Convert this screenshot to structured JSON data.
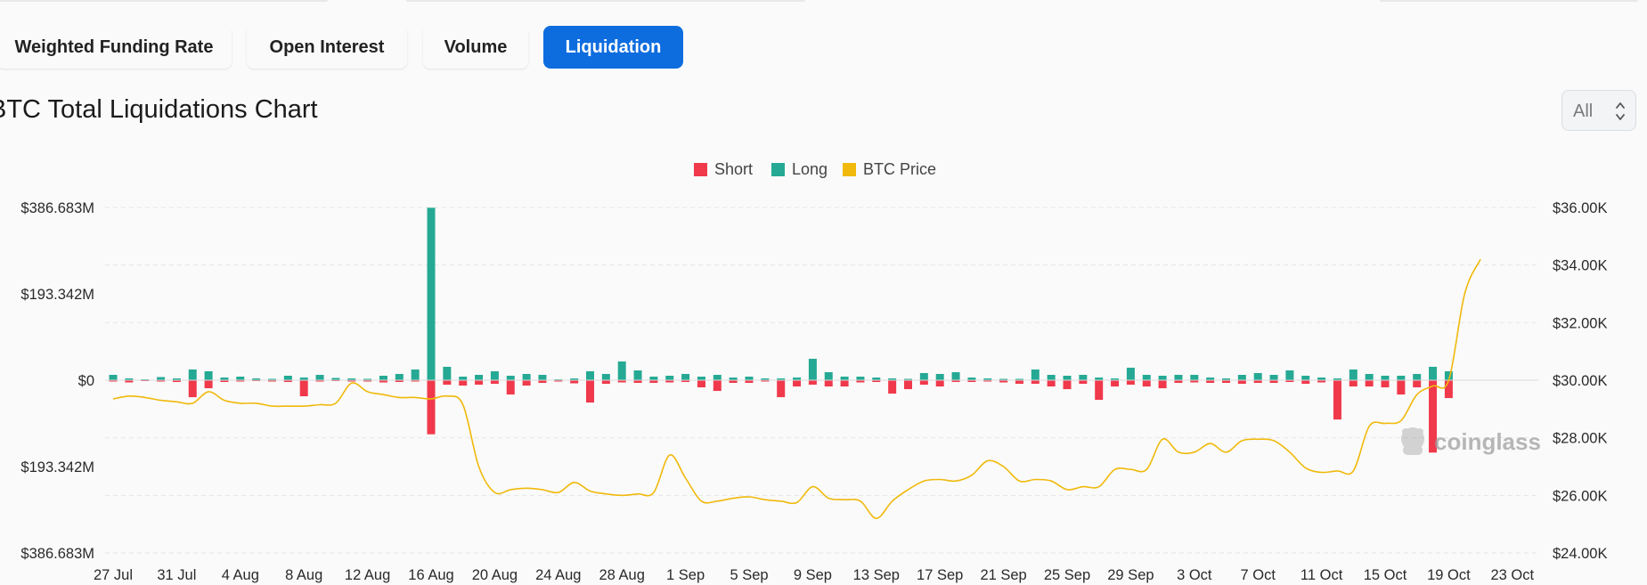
{
  "tabs": [
    {
      "label": "Weighted Funding Rate",
      "active": false
    },
    {
      "label": "Open Interest",
      "active": false
    },
    {
      "label": "Volume",
      "active": false
    },
    {
      "label": "Liquidation",
      "active": true
    }
  ],
  "title": "BTC Total Liquidations Chart",
  "range_select": {
    "value": "All"
  },
  "colors": {
    "short": "#f0394b",
    "long": "#26a994",
    "price": "#f0b90b",
    "accent": "#0d6ddf"
  },
  "watermark": "coinglass",
  "chart_data": {
    "type": "bar",
    "title": "BTC Total Liquidations Chart",
    "legend": [
      {
        "name": "Short",
        "color": "#f0394b"
      },
      {
        "name": "Long",
        "color": "#26a994"
      },
      {
        "name": "BTC Price",
        "color": "#f0b90b"
      }
    ],
    "legend_position": "top-center",
    "grid": true,
    "x_tick_labels": [
      "27 Jul",
      "31 Jul",
      "4 Aug",
      "8 Aug",
      "12 Aug",
      "16 Aug",
      "20 Aug",
      "24 Aug",
      "28 Aug",
      "1 Sep",
      "5 Sep",
      "9 Sep",
      "13 Sep",
      "17 Sep",
      "21 Sep",
      "25 Sep",
      "29 Sep",
      "3 Oct",
      "7 Oct",
      "11 Oct",
      "15 Oct",
      "19 Oct",
      "23 Oct"
    ],
    "y_left_tick_labels": [
      "$386.683M",
      "$193.342M",
      "$0",
      "$193.342M",
      "$386.683M"
    ],
    "y_left_range": [
      -386.683,
      386.683
    ],
    "y_right_tick_labels": [
      "$36.00K",
      "$34.00K",
      "$32.00K",
      "$30.00K",
      "$28.00K",
      "$26.00K",
      "$24.00K"
    ],
    "y_right_range": [
      24000,
      36000
    ],
    "x_start": "2023-07-27",
    "series": [
      {
        "name": "Long",
        "axis": "left",
        "values": [
          12,
          4,
          2,
          7,
          4,
          24,
          20,
          6,
          8,
          4,
          3,
          10,
          6,
          12,
          5,
          4,
          3,
          10,
          14,
          24,
          386,
          30,
          8,
          12,
          20,
          10,
          14,
          12,
          2,
          4,
          20,
          14,
          42,
          22,
          8,
          10,
          14,
          8,
          12,
          6,
          8,
          4,
          4,
          6,
          48,
          18,
          8,
          8,
          6,
          4,
          3,
          16,
          14,
          18,
          6,
          4,
          3,
          3,
          24,
          12,
          10,
          12,
          6,
          4,
          28,
          12,
          10,
          12,
          12,
          6,
          4,
          12,
          16,
          12,
          22,
          10,
          6,
          4,
          24,
          14,
          10,
          10,
          14,
          30,
          20
        ],
        "unit": "$M"
      },
      {
        "name": "Short",
        "axis": "left",
        "values": [
          3,
          5,
          2,
          3,
          4,
          38,
          18,
          4,
          3,
          2,
          3,
          4,
          36,
          3,
          2,
          3,
          3,
          5,
          4,
          3,
          121,
          10,
          12,
          10,
          8,
          32,
          12,
          6,
          3,
          7,
          50,
          8,
          5,
          6,
          6,
          5,
          4,
          16,
          24,
          6,
          6,
          3,
          38,
          14,
          10,
          14,
          14,
          5,
          4,
          30,
          20,
          10,
          14,
          4,
          4,
          3,
          5,
          8,
          8,
          14,
          20,
          8,
          44,
          14,
          10,
          14,
          18,
          6,
          5,
          6,
          6,
          8,
          6,
          6,
          4,
          8,
          5,
          88,
          14,
          14,
          16,
          32,
          16,
          162,
          40
        ],
        "unit": "$M"
      },
      {
        "name": "BTC Price",
        "axis": "right",
        "values": [
          29350,
          29450,
          29400,
          29300,
          29250,
          29200,
          29600,
          29300,
          29200,
          29200,
          29100,
          29100,
          29100,
          29150,
          29200,
          29900,
          29600,
          29500,
          29400,
          29400,
          29350,
          29450,
          29150,
          27000,
          26100,
          26200,
          26250,
          26200,
          26100,
          26450,
          26150,
          26050,
          26000,
          26050,
          26100,
          27400,
          26600,
          25800,
          25800,
          25900,
          25950,
          25850,
          25800,
          25750,
          26300,
          25900,
          25850,
          25800,
          25200,
          25800,
          26200,
          26500,
          26550,
          26500,
          26700,
          27200,
          27000,
          26500,
          26550,
          26500,
          26200,
          26300,
          26300,
          26900,
          26900,
          26900,
          27950,
          27500,
          27500,
          27800,
          27500,
          27900,
          27950,
          27900,
          27500,
          26950,
          26800,
          26850,
          26850,
          28400,
          28500,
          28600,
          29500,
          29800,
          30000,
          33000,
          34200
        ],
        "unit": "$"
      }
    ]
  }
}
